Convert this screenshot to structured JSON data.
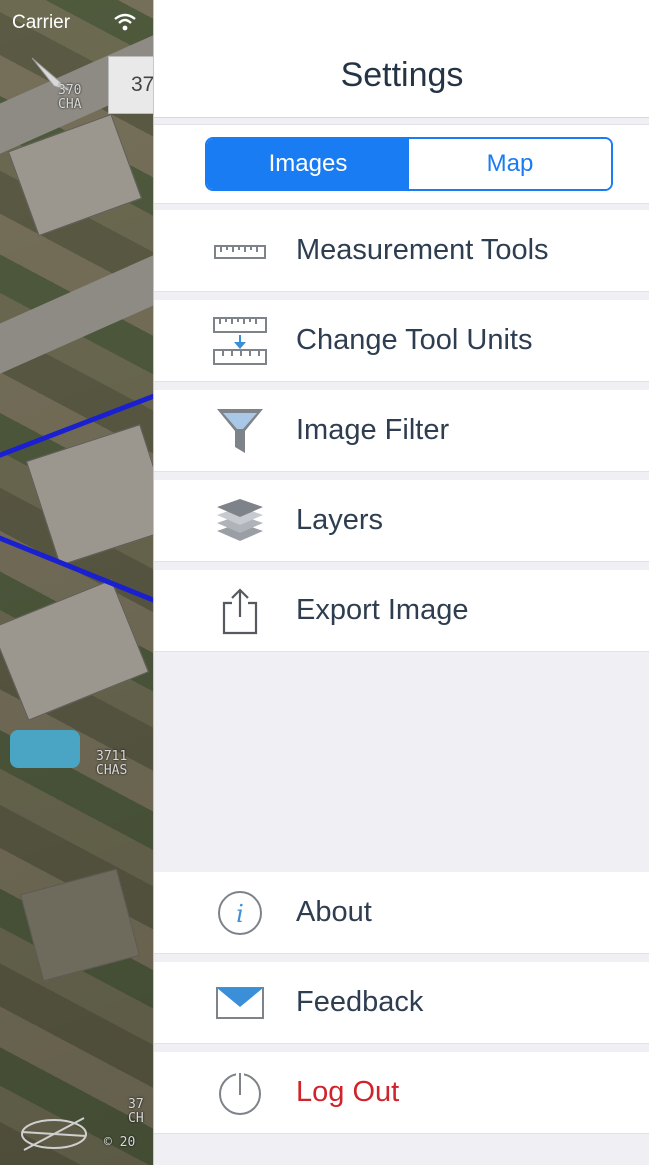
{
  "status_bar": {
    "carrier": "Carrier"
  },
  "map": {
    "address_box": "37",
    "labels": [
      "370\nCHA",
      "3711\nCHAS",
      "37\nCH",
      "© 20"
    ]
  },
  "settings": {
    "title": "Settings",
    "segments": [
      {
        "label": "Images",
        "selected": true
      },
      {
        "label": "Map",
        "selected": false
      }
    ],
    "tools": [
      {
        "label": "Measurement Tools",
        "icon": "ruler-icon"
      },
      {
        "label": "Change Tool Units",
        "icon": "change-units-icon"
      },
      {
        "label": "Image Filter",
        "icon": "filter-icon"
      },
      {
        "label": "Layers",
        "icon": "layers-icon"
      },
      {
        "label": "Export Image",
        "icon": "share-icon"
      }
    ],
    "bottom": [
      {
        "label": "About",
        "icon": "info-icon"
      },
      {
        "label": "Feedback",
        "icon": "envelope-icon"
      },
      {
        "label": "Log Out",
        "icon": "power-icon"
      }
    ]
  },
  "colors": {
    "accent": "#1a7cf2",
    "logout": "#d0242a",
    "panel_bg": "#efeff4",
    "text": "#2e3e50"
  }
}
